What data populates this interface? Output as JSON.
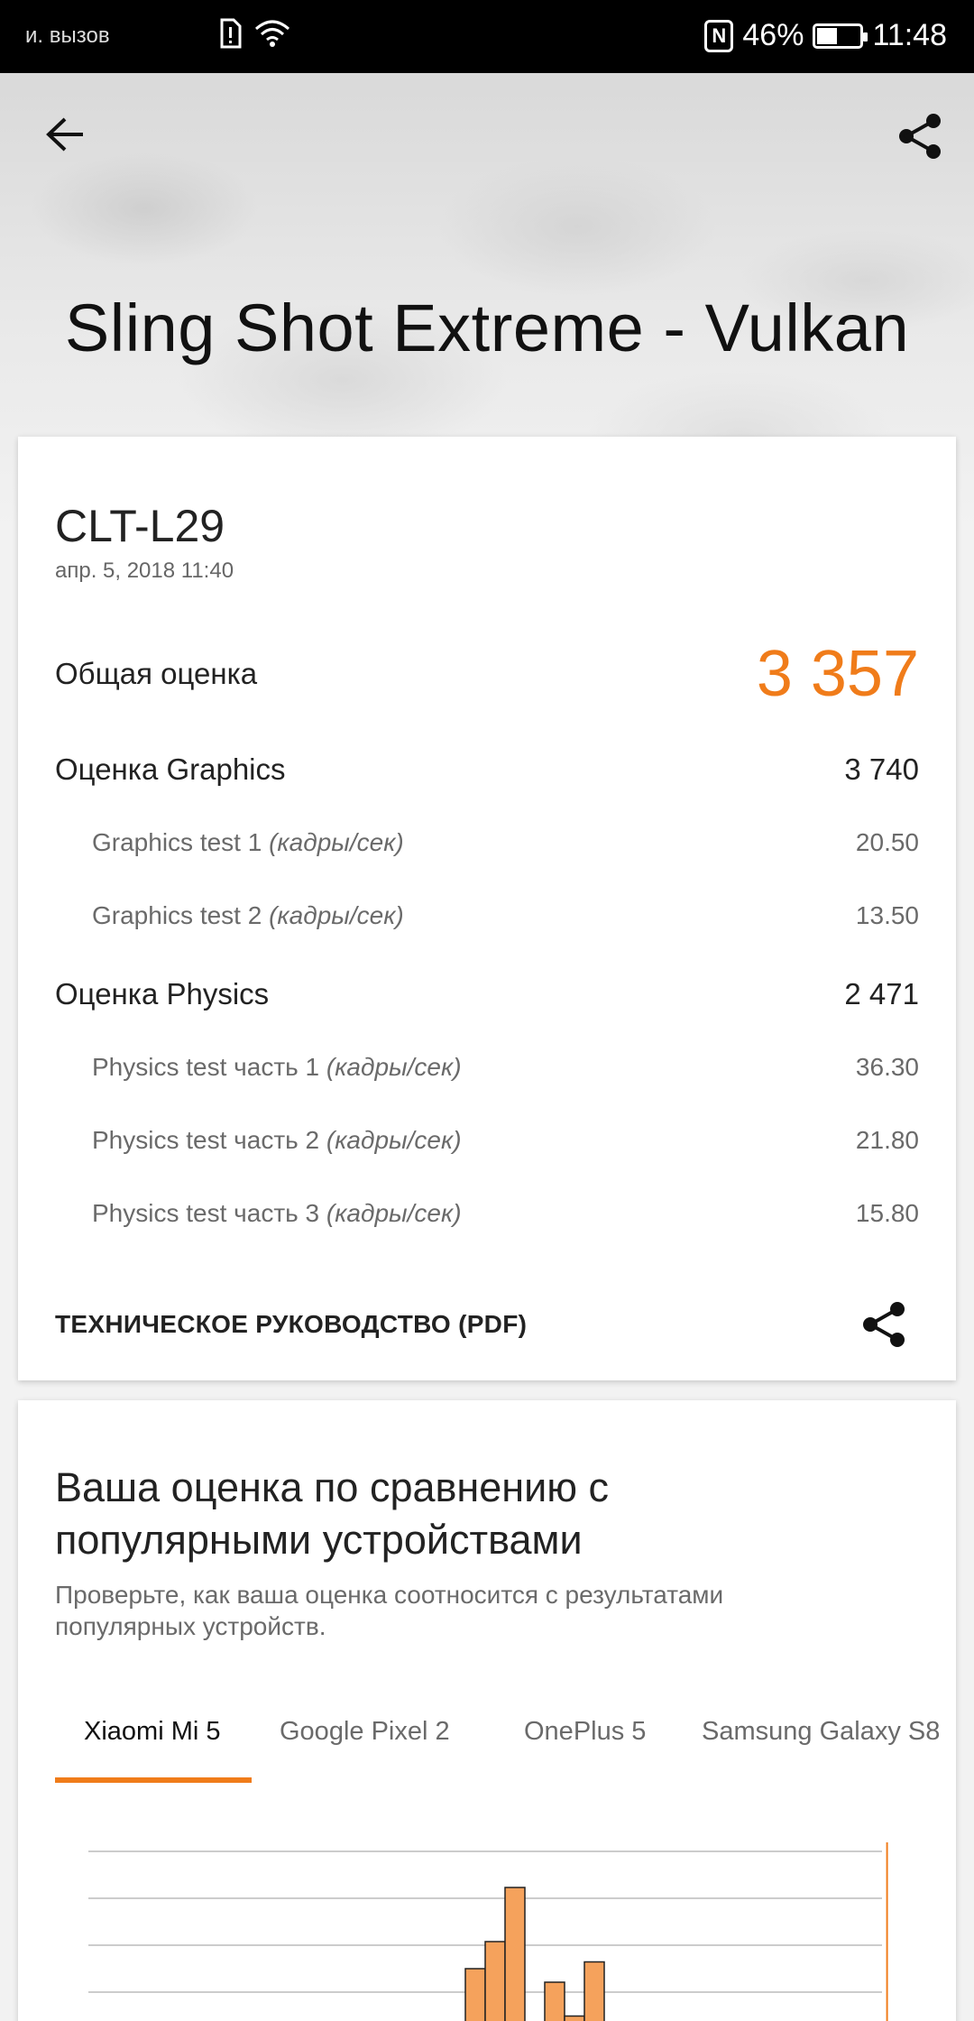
{
  "status_bar": {
    "carrier_text": "вызов",
    "carrier_prefix": "и.",
    "battery_percent": "46%",
    "battery_level": 0.46,
    "time": "11:48"
  },
  "header": {
    "title": "Sling Shot Extreme - Vulkan"
  },
  "result": {
    "device": "CLT-L29",
    "date": "апр. 5, 2018 11:40",
    "overall_label": "Общая оценка",
    "overall_value": "3 357",
    "graphics_label": "Оценка Graphics",
    "graphics_value": "3 740",
    "graphics_tests": [
      {
        "name": "Graphics test 1",
        "unit": "(кадры/сек)",
        "value": "20.50"
      },
      {
        "name": "Graphics test 2",
        "unit": "(кадры/сек)",
        "value": "13.50"
      }
    ],
    "physics_label": "Оценка Physics",
    "physics_value": "2 471",
    "physics_tests": [
      {
        "name": "Physics test часть 1",
        "unit": "(кадры/сек)",
        "value": "36.30"
      },
      {
        "name": "Physics test часть 2",
        "unit": "(кадры/сек)",
        "value": "21.80"
      },
      {
        "name": "Physics test часть 3",
        "unit": "(кадры/сек)",
        "value": "15.80"
      }
    ],
    "tech_guide_label": "ТЕХНИЧЕСКОЕ РУКОВОДСТВО (PDF)"
  },
  "comparison": {
    "title": "Ваша оценка по сравнению с популярными устройствами",
    "description": "Проверьте, как ваша оценка соотносится с результатами популярных устройств.",
    "tabs": [
      "Xiaomi Mi 5",
      "Google Pixel 2",
      "OnePlus 5",
      "Samsung Galaxy S8"
    ],
    "active_tab": 0
  },
  "colors": {
    "accent": "#f07c1a",
    "bar_fill": "#f5a25c",
    "bar_stroke": "#222222",
    "grid": "#bbbbbb"
  },
  "chart_data": {
    "type": "bar",
    "values": [
      0,
      0,
      0,
      0,
      0,
      0,
      0,
      0,
      0,
      0,
      0,
      0,
      0,
      0,
      0,
      0,
      0,
      0,
      0,
      0.8,
      1.2,
      2.0,
      0,
      0.6,
      0.1,
      0.9,
      0,
      0,
      0,
      0,
      0,
      0,
      0,
      0,
      0,
      0,
      0,
      0,
      0,
      0
    ],
    "marker_at": 0.995,
    "grid": true
  }
}
